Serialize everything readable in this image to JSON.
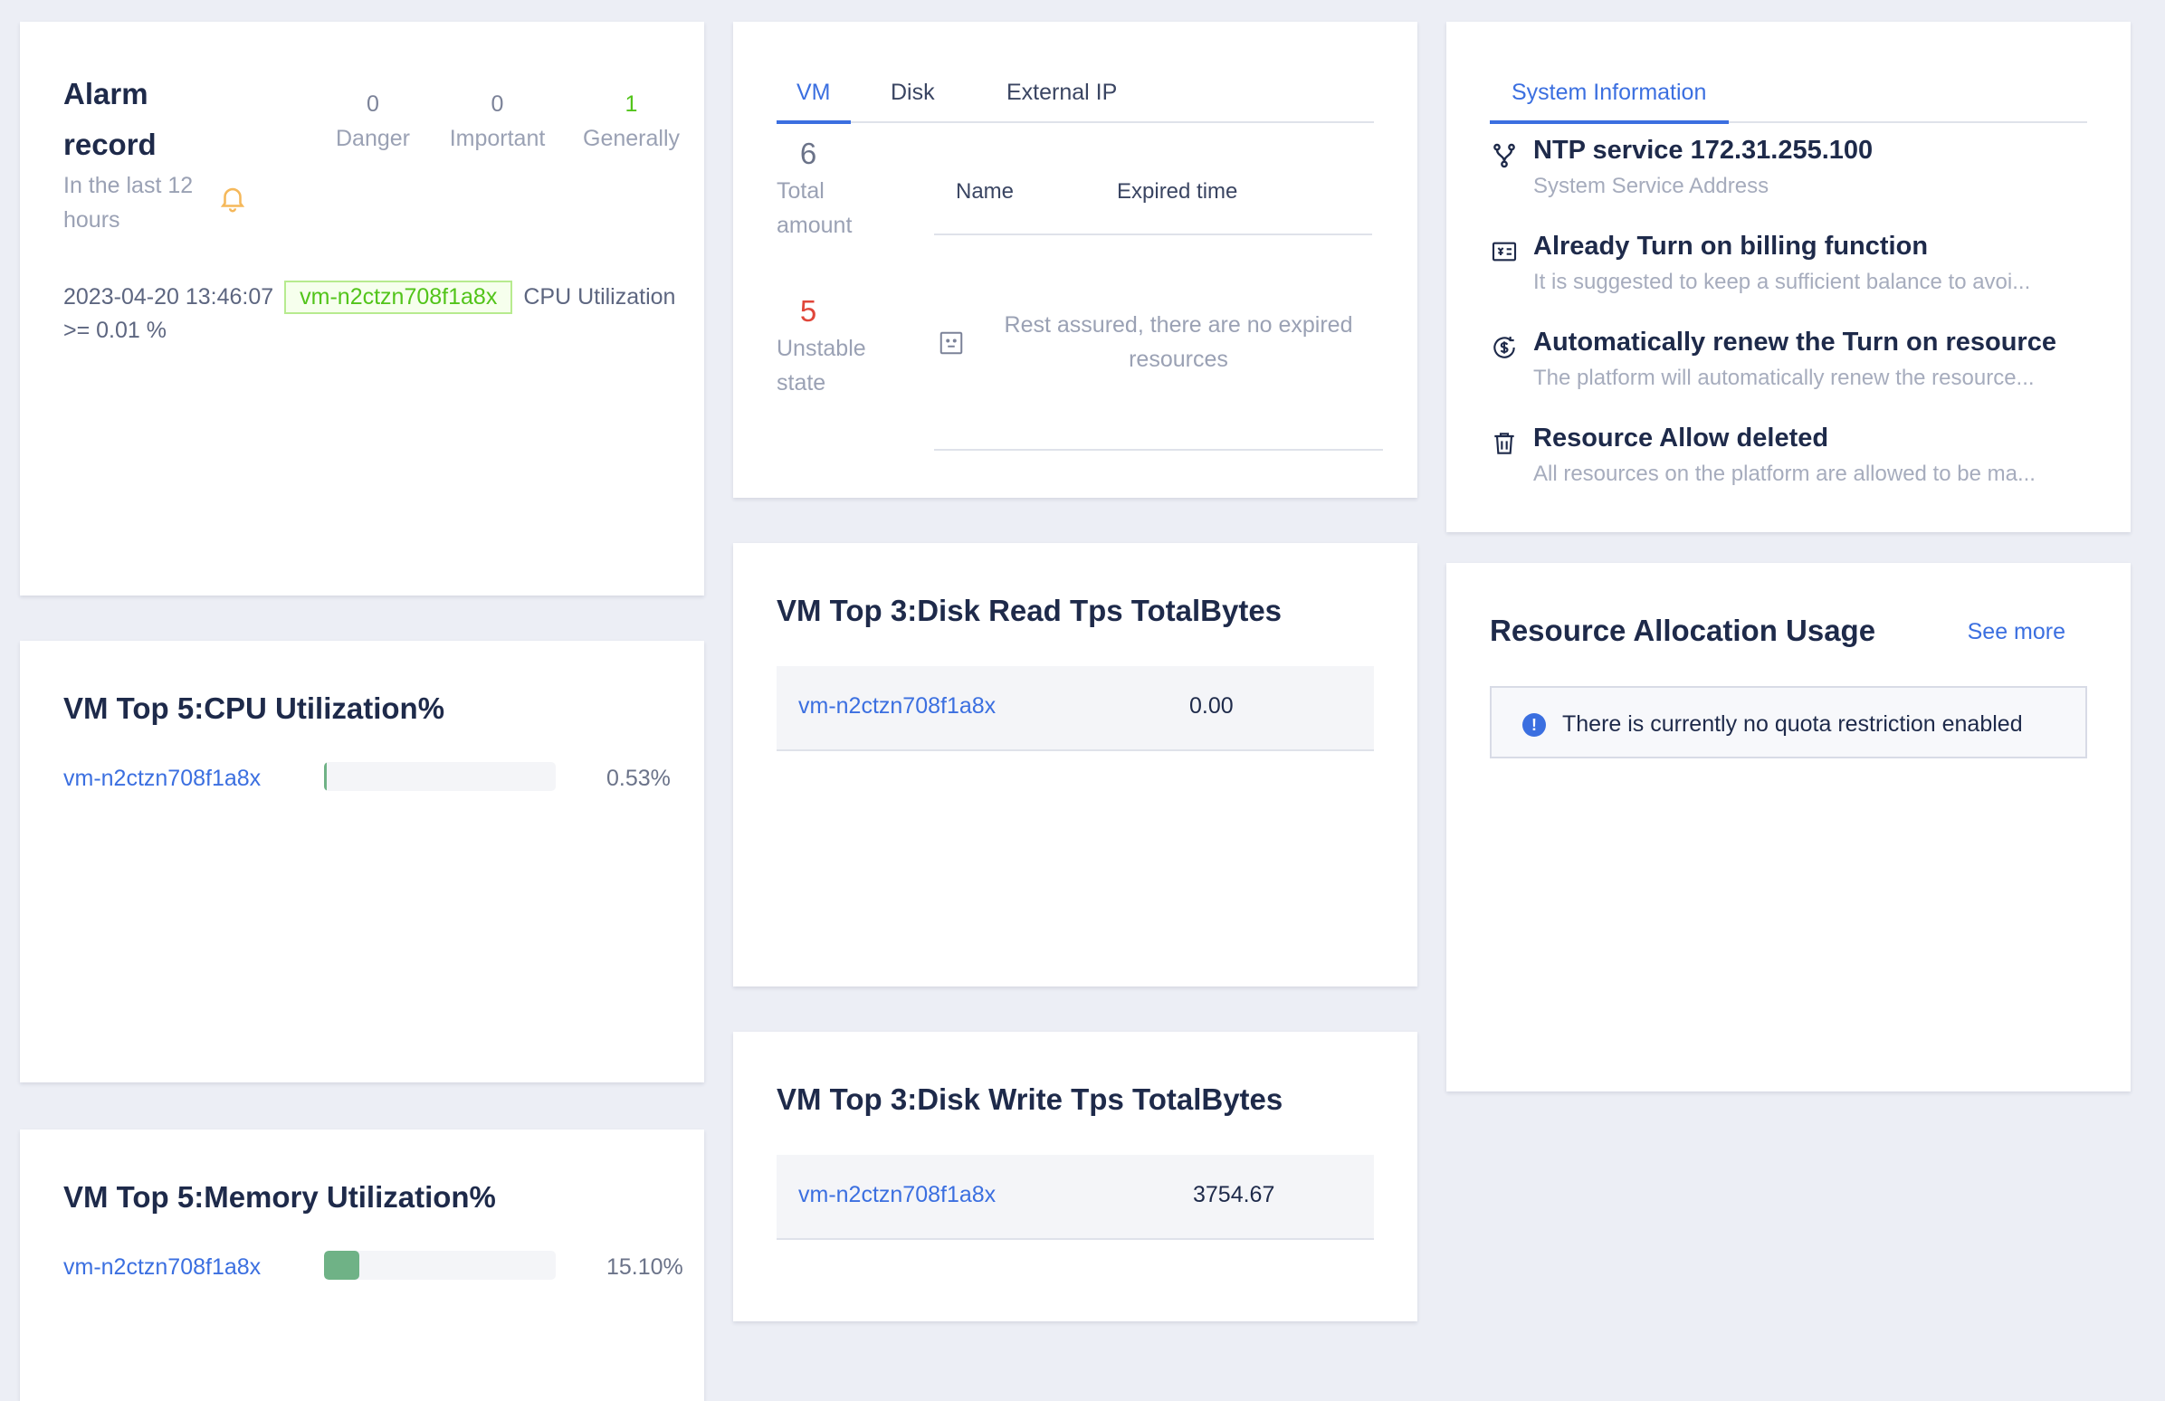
{
  "alarm": {
    "title": "Alarm record",
    "subtitle": "In the last 12 hours",
    "stats": [
      {
        "value": "0",
        "label": "Danger"
      },
      {
        "value": "0",
        "label": "Important"
      },
      {
        "value": "1",
        "label": "Generally"
      }
    ],
    "records": [
      {
        "time": "2023-04-20 13:46:07",
        "vm": "vm-n2ctzn708f1a8x",
        "text": "CPU Utilization >= 0.01 %"
      }
    ]
  },
  "resources": {
    "tabs": [
      "VM",
      "Disk",
      "External IP"
    ],
    "active_tab": "VM",
    "total_value": "6",
    "total_label": "Total amount",
    "unstable_value": "5",
    "unstable_label": "Unstable state",
    "table_headers": [
      "Name",
      "Expired time"
    ],
    "empty_text": "Rest assured, there are no expired resources"
  },
  "system_info": {
    "tab": "System Information",
    "items": [
      {
        "title": "NTP service 172.31.255.100",
        "desc": "System Service Address",
        "icon": "fork-icon"
      },
      {
        "title": "Already Turn on billing function",
        "desc": "It is suggested to keep a sufficient balance to avoi...",
        "icon": "billing-icon"
      },
      {
        "title": "Automatically renew the Turn on resource",
        "desc": "The platform will automatically renew the resource...",
        "icon": "renew-dollar-icon"
      },
      {
        "title": "Resource Allow deleted",
        "desc": "All resources on the platform are allowed to be ma...",
        "icon": "trash-icon"
      }
    ]
  },
  "cpu_top": {
    "title": "VM Top 5:CPU Utilization%",
    "rows": [
      {
        "vm": "vm-n2ctzn708f1a8x",
        "value": "0.53%",
        "fraction": 0.0053
      }
    ]
  },
  "mem_top": {
    "title": "VM Top 5:Memory Utilization%",
    "rows": [
      {
        "vm": "vm-n2ctzn708f1a8x",
        "value": "15.10%",
        "fraction": 0.151
      }
    ]
  },
  "disk_read": {
    "title": "VM Top 3:Disk Read Tps TotalBytes",
    "rows": [
      {
        "vm": "vm-n2ctzn708f1a8x",
        "value": "0.00"
      }
    ]
  },
  "disk_write": {
    "title": "VM Top 3:Disk Write Tps TotalBytes",
    "rows": [
      {
        "vm": "vm-n2ctzn708f1a8x",
        "value": "3754.67"
      }
    ]
  },
  "resource_alloc": {
    "title": "Resource Allocation Usage",
    "see_more": "See more",
    "notice": "There is currently no quota restriction enabled"
  },
  "colors": {
    "accent": "#3b6fe0",
    "success": "#52c41a",
    "danger": "#e0463a",
    "bar_fill": "#6fb286"
  }
}
